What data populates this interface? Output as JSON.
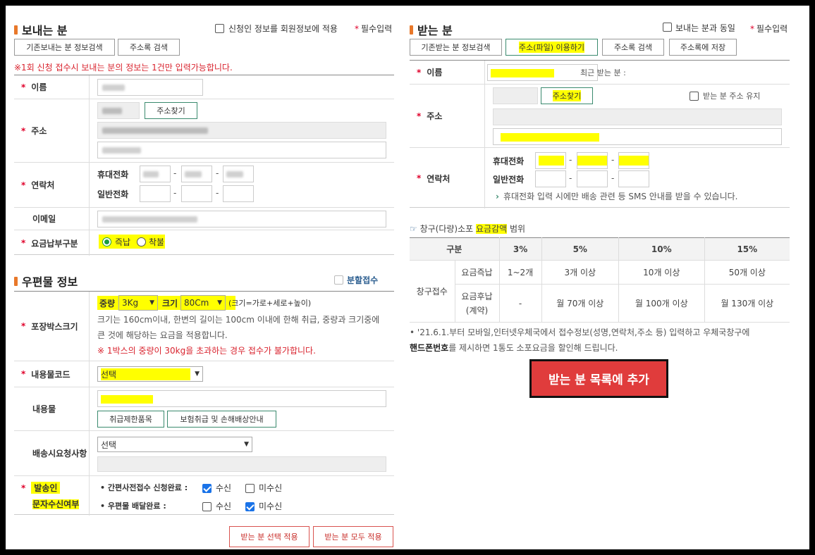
{
  "sender": {
    "title": "보내는 분",
    "apply_member_label": "신청인 정보를 회원정보에 적용",
    "required_label": "필수입력",
    "btn_prev_search": "기존보내는 분 정보검색",
    "btn_addressbook": "주소록 검색",
    "notice": "※1회 신청 접수시 보내는 분의 정보는 1건만 입력가능합니다.",
    "name_label": "이름",
    "address_label": "주소",
    "find_address_btn": "주소찾기",
    "contact_label": "연락처",
    "mobile_label": "휴대전화",
    "phone_label": "일반전화",
    "email_label": "이메일",
    "payment_label": "요금납부구분",
    "pay_prepaid": "즉납",
    "pay_cod": "착불",
    "payment_selected": "즉납"
  },
  "parcel": {
    "title": "우편물 정보",
    "split_label": "분할접수",
    "box_size_label": "포장박스크기",
    "weight_label": "중량",
    "weight_value": "3Kg",
    "size_label": "크기",
    "size_value": "80Cm",
    "size_hint": "(크기=가로+세로+높이)",
    "size_desc1": "크기는 160cm이내, 한변의 길이는 100cm 이내에 한해 취급, 중량과 크기중에",
    "size_desc2": "큰 것에 해당하는 요금을 적용합니다.",
    "size_warning": "※ 1박스의 중량이 30kg을 초과하는 경우 접수가 불가합니다.",
    "content_code_label": "내용물코드",
    "content_code_value": "선택",
    "content_label": "내용물",
    "btn_restricted": "취급제한품목",
    "btn_insurance": "보험취급 및 손해배상안내",
    "delivery_request_label": "배송시요청사항",
    "delivery_request_value": "선택",
    "sms_label_line1": "발송인",
    "sms_label_line2": "문자수신여부",
    "sms_row1_label": "• 간편사전접수 신청완료 :",
    "sms_row2_label": "• 우편물 배달완료 :",
    "receive": "수신",
    "not_receive": "미수신",
    "sms_row1_selected": "수신",
    "sms_row2_selected": "미수신",
    "btn_apply_selected": "받는 분 선택 적용",
    "btn_apply_all": "받는 분 모두 적용"
  },
  "receiver": {
    "title": "받는 분",
    "same_as_sender": "보내는 분과 동일",
    "required_label": "필수입력",
    "btn_prev_search": "기존받는 분 정보검색",
    "btn_file_address": "주소(파일) 이용하기",
    "btn_addressbook": "주소록 검색",
    "btn_save_addressbook": "주소록에 저장",
    "name_label": "이름",
    "recent_label": "최근 받는 분 :",
    "address_label": "주소",
    "find_address_btn": "주소찾기",
    "keep_address": "받는 분 주소 유지",
    "contact_label": "연락처",
    "mobile_label": "휴대전화",
    "phone_label": "일반전화",
    "sms_note": "휴대전화 입력 시에만 배송 관련 등 SMS 안내를 받을 수 있습니다."
  },
  "discount": {
    "title_prefix": "창구(다량)소포 ",
    "title_highlight": "요금감액",
    "title_suffix": " 범위",
    "headers": [
      "구분",
      "3%",
      "5%",
      "10%",
      "15%"
    ],
    "row_group": "창구접수",
    "rows": [
      {
        "label": "요금즉납",
        "values": [
          "1~2개",
          "3개 이상",
          "10개 이상",
          "50개 이상"
        ]
      },
      {
        "label": "요금후납\n(계약)",
        "values": [
          "-",
          "월 70개 이상",
          "월 100개 이상",
          "월 130개 이상"
        ]
      }
    ],
    "note_line1": "• '21.6.1.부터 모바일,인터넷우체국에서 접수정보(성명,연락처,주소 등) 입력하고 우체국창구에",
    "note_bold": "핸드폰번호",
    "note_line2": "를 제시하면 1통도 소포요금을 할인해 드립니다.",
    "add_button": "받는 분 목록에 추가"
  }
}
